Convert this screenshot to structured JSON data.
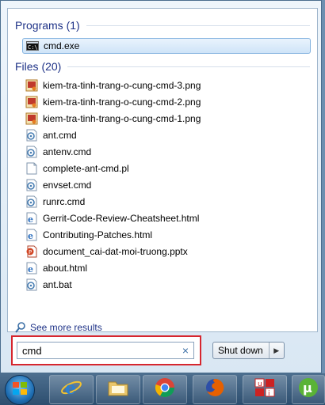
{
  "programs": {
    "header": "Programs (1)",
    "items": [
      {
        "label": "cmd.exe",
        "icon": "cmd-icon"
      }
    ]
  },
  "files": {
    "header": "Files (20)",
    "items": [
      {
        "label": "kiem-tra-tinh-trang-o-cung-cmd-3.png",
        "icon": "image-file-icon"
      },
      {
        "label": "kiem-tra-tinh-trang-o-cung-cmd-2.png",
        "icon": "image-file-icon"
      },
      {
        "label": "kiem-tra-tinh-trang-o-cung-cmd-1.png",
        "icon": "image-file-icon"
      },
      {
        "label": "ant.cmd",
        "icon": "script-file-icon"
      },
      {
        "label": "antenv.cmd",
        "icon": "script-file-icon"
      },
      {
        "label": "complete-ant-cmd.pl",
        "icon": "blank-file-icon"
      },
      {
        "label": "envset.cmd",
        "icon": "script-file-icon"
      },
      {
        "label": "runrc.cmd",
        "icon": "script-file-icon"
      },
      {
        "label": "Gerrit-Code-Review-Cheatsheet.html",
        "icon": "ie-file-icon"
      },
      {
        "label": "Contributing-Patches.html",
        "icon": "ie-file-icon"
      },
      {
        "label": "document_cai-dat-moi-truong.pptx",
        "icon": "powerpoint-file-icon"
      },
      {
        "label": "about.html",
        "icon": "ie-file-icon"
      },
      {
        "label": "ant.bat",
        "icon": "script-file-icon"
      }
    ]
  },
  "see_more": "See more results",
  "search": {
    "value": "cmd",
    "clear_symbol": "×"
  },
  "shutdown": {
    "label": "Shut down",
    "arrow": "▶"
  },
  "taskbar": {
    "items": [
      "start-orb",
      "internet-explorer",
      "file-explorer",
      "chrome",
      "firefox",
      "unikey",
      "utorrent"
    ]
  },
  "colors": {
    "accent": "#1e3287",
    "highlight": "#d6262e"
  }
}
